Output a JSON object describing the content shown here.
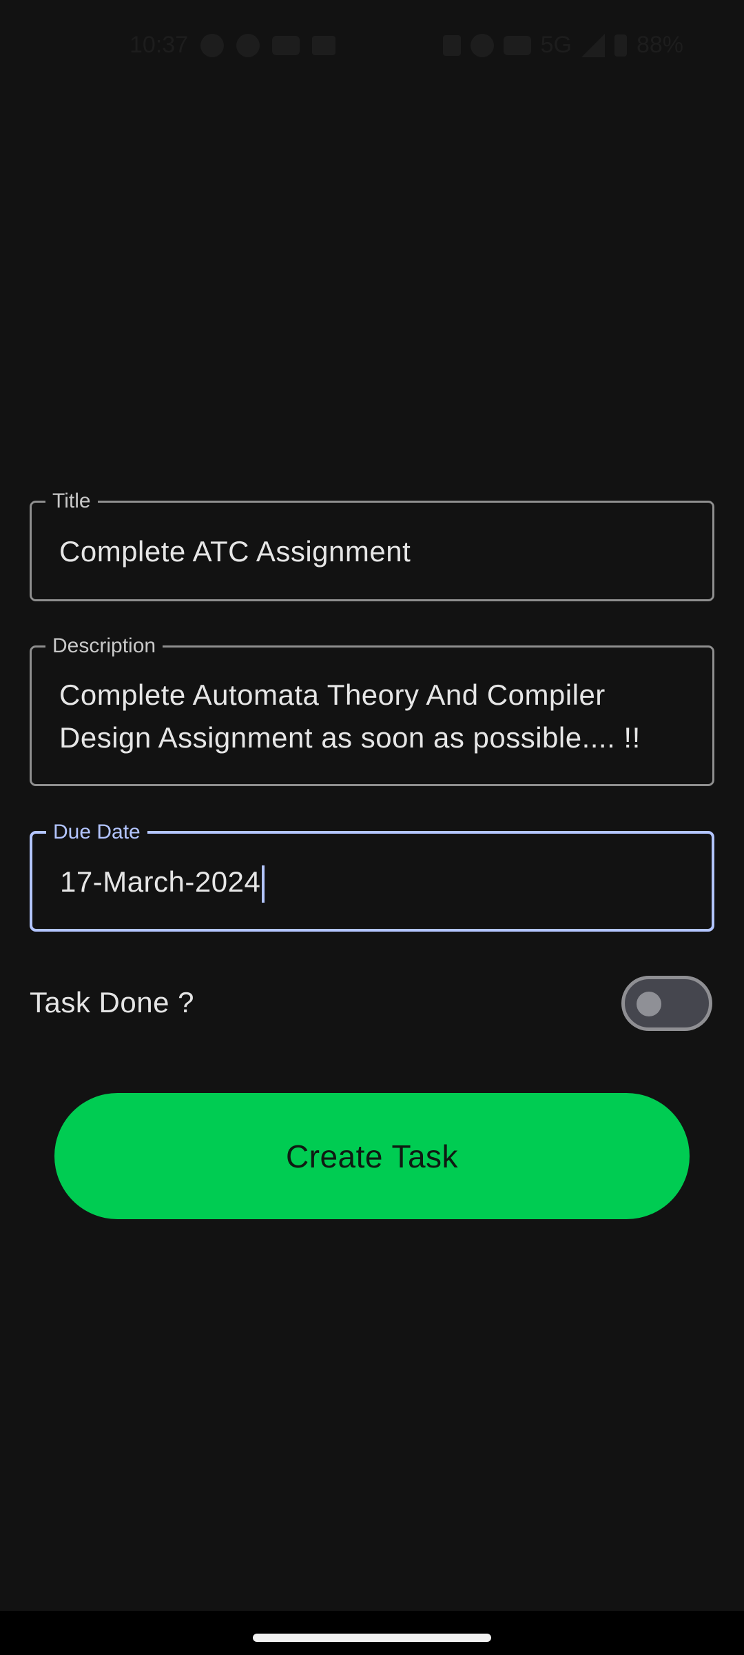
{
  "status_bar": {
    "time": "10:37",
    "network": "5G",
    "battery": "88%",
    "left_icons": [
      "whatsapp-icon",
      "github-icon",
      "youtube-icon",
      "gmail-icon"
    ],
    "right_icons": [
      "bluetooth-icon",
      "hotspot-icon",
      "volte-icon",
      "signal-icon",
      "battery-icon"
    ]
  },
  "form": {
    "title": {
      "label": "Title",
      "value": "Complete ATC Assignment"
    },
    "description": {
      "label": "Description",
      "line1": "Complete Automata Theory And Compiler",
      "line2": "Design Assignment as soon as possible.... !!"
    },
    "due_date": {
      "label": "Due Date",
      "value": "17-March-2024"
    },
    "task_done": {
      "label": "Task Done ?",
      "checked": false
    }
  },
  "actions": {
    "create_label": "Create Task"
  },
  "colors": {
    "accent": "#b3c5ff",
    "primary_button": "#00cc52",
    "background": "#121212"
  }
}
